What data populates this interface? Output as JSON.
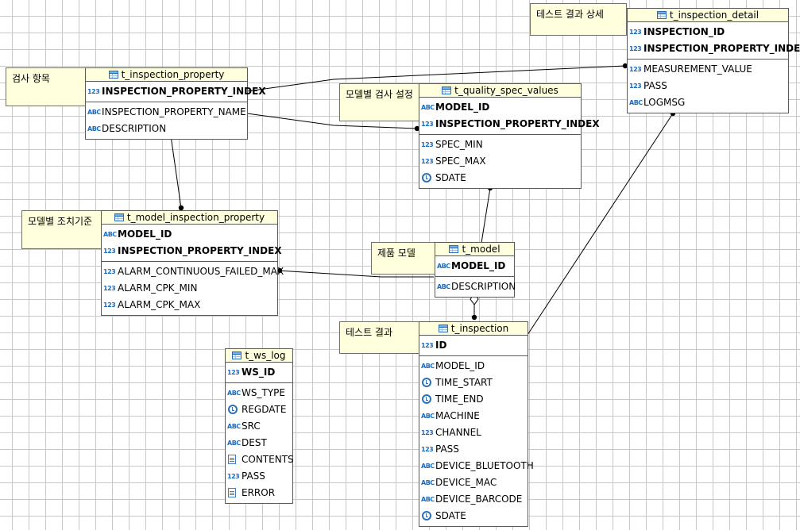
{
  "notes": {
    "detail": "테스트 결과 상세",
    "property": "검사 항목",
    "quality": "모델별 검사 설정",
    "model_prop": "모델별 조치기준",
    "model": "제품 모델",
    "inspection": "테스트 결과"
  },
  "tables": {
    "t_inspection_detail": {
      "name": "t_inspection_detail",
      "pk": [
        {
          "label": "INSPECTION_ID",
          "icon": "number-key-icon"
        },
        {
          "label": "INSPECTION_PROPERTY_INDEX",
          "icon": "number-key-icon"
        }
      ],
      "cols": [
        {
          "label": "MEASUREMENT_VALUE",
          "icon": "number-icon"
        },
        {
          "label": "PASS",
          "icon": "number-icon"
        },
        {
          "label": "LOGMSG",
          "icon": "text-icon"
        }
      ]
    },
    "t_inspection_property": {
      "name": "t_inspection_property",
      "pk": [
        {
          "label": "INSPECTION_PROPERTY_INDEX",
          "icon": "number-key-icon"
        }
      ],
      "cols": [
        {
          "label": "INSPECTION_PROPERTY_NAME",
          "icon": "text-icon"
        },
        {
          "label": "DESCRIPTION",
          "icon": "text-icon"
        }
      ]
    },
    "t_quality_spec_values": {
      "name": "t_quality_spec_values",
      "pk": [
        {
          "label": "MODEL_ID",
          "icon": "text-key-icon"
        },
        {
          "label": "INSPECTION_PROPERTY_INDEX",
          "icon": "number-key-icon"
        }
      ],
      "cols": [
        {
          "label": "SPEC_MIN",
          "icon": "number-icon"
        },
        {
          "label": "SPEC_MAX",
          "icon": "number-icon"
        },
        {
          "label": "SDATE",
          "icon": "clock-icon"
        }
      ]
    },
    "t_model_inspection_property": {
      "name": "t_model_inspection_property",
      "pk": [
        {
          "label": "MODEL_ID",
          "icon": "text-key-icon"
        },
        {
          "label": "INSPECTION_PROPERTY_INDEX",
          "icon": "number-key-icon"
        }
      ],
      "cols": [
        {
          "label": "ALARM_CONTINUOUS_FAILED_MAX",
          "icon": "number-icon"
        },
        {
          "label": "ALARM_CPK_MIN",
          "icon": "number-icon"
        },
        {
          "label": "ALARM_CPK_MAX",
          "icon": "number-icon"
        }
      ]
    },
    "t_model": {
      "name": "t_model",
      "pk": [
        {
          "label": "MODEL_ID",
          "icon": "text-key-icon"
        }
      ],
      "cols": [
        {
          "label": "DESCRIPTION",
          "icon": "text-icon"
        }
      ]
    },
    "t_inspection": {
      "name": "t_inspection",
      "pk": [
        {
          "label": "ID",
          "icon": "number-key-icon"
        }
      ],
      "cols": [
        {
          "label": "MODEL_ID",
          "icon": "text-icon"
        },
        {
          "label": "TIME_START",
          "icon": "clock-icon"
        },
        {
          "label": "TIME_END",
          "icon": "clock-icon"
        },
        {
          "label": "MACHINE",
          "icon": "text-icon"
        },
        {
          "label": "CHANNEL",
          "icon": "number-icon"
        },
        {
          "label": "PASS",
          "icon": "number-icon"
        },
        {
          "label": "DEVICE_BLUETOOTH",
          "icon": "text-icon"
        },
        {
          "label": "DEVICE_MAC",
          "icon": "text-icon"
        },
        {
          "label": "DEVICE_BARCODE",
          "icon": "text-icon"
        },
        {
          "label": "SDATE",
          "icon": "clock-icon"
        }
      ]
    },
    "t_ws_log": {
      "name": "t_ws_log",
      "pk": [
        {
          "label": "WS_ID",
          "icon": "number-key-icon"
        }
      ],
      "cols": [
        {
          "label": "WS_TYPE",
          "icon": "text-icon"
        },
        {
          "label": "REGDATE",
          "icon": "clock-icon"
        },
        {
          "label": "SRC",
          "icon": "text-icon"
        },
        {
          "label": "DEST",
          "icon": "text-icon"
        },
        {
          "label": "CONTENTS",
          "icon": "document-icon"
        },
        {
          "label": "PASS",
          "icon": "number-icon"
        },
        {
          "label": "ERROR",
          "icon": "document-icon"
        }
      ]
    }
  },
  "icon_text": {
    "number": "123",
    "text": "ABC"
  },
  "colors": {
    "note_bg": "#ffffdd",
    "icon_blue": "#1b6bbd",
    "grid": "#c8c8c8"
  }
}
